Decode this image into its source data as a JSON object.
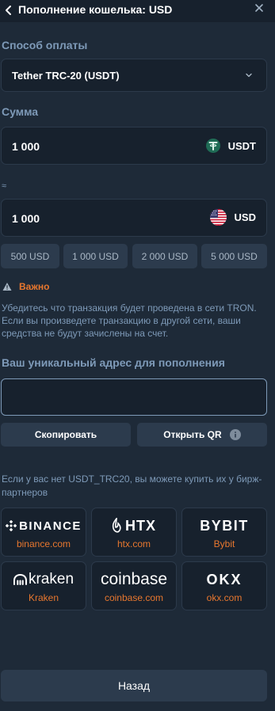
{
  "header": {
    "title": "Пополнение кошелька: USD"
  },
  "payment": {
    "label": "Способ оплаты",
    "selected": "Tether TRC-20 (USDT)"
  },
  "amount": {
    "label": "Сумма",
    "crypto_value": "1 000",
    "crypto_currency": "USDT",
    "approx_symbol": "≈",
    "fiat_value": "1 000",
    "fiat_currency": "USD"
  },
  "quick_amounts": [
    "500 USD",
    "1 000 USD",
    "2 000 USD",
    "5 000 USD"
  ],
  "warning": {
    "title": "Важно",
    "text": "Убедитесь что транзакция будет проведена в сети TRON. Если вы произведете транзакцию в другой сети, ваши средства не будут зачислены на счет."
  },
  "address": {
    "label": "Ваш уникальный адрес для пополнения",
    "value": ""
  },
  "actions": {
    "copy": "Скопировать",
    "open_qr": "Открыть QR"
  },
  "partners": {
    "text": "Если у вас нет USDT_TRC20, вы можете купить их у бирж-партнеров",
    "exchanges": [
      {
        "logo": "BINANCE",
        "link": "binance.com"
      },
      {
        "logo": "HTX",
        "link": "htx.com"
      },
      {
        "logo": "BYBIT",
        "link": "Bybit"
      },
      {
        "logo": "kraken",
        "link": "Kraken"
      },
      {
        "logo": "coinbase",
        "link": "coinbase.com"
      },
      {
        "logo": "OKX",
        "link": "okx.com"
      }
    ]
  },
  "footer": {
    "back": "Назад"
  },
  "colors": {
    "background": "#1e2a38",
    "panel": "#17212d",
    "button": "#2c3b4d",
    "muted": "#7e9ab8",
    "accent": "#e8772e",
    "tether": "#26a17b"
  },
  "icons": [
    "arrow-left-icon",
    "close-icon",
    "chevron-down-icon",
    "tether-icon",
    "us-flag-icon",
    "warning-icon",
    "info-icon"
  ]
}
